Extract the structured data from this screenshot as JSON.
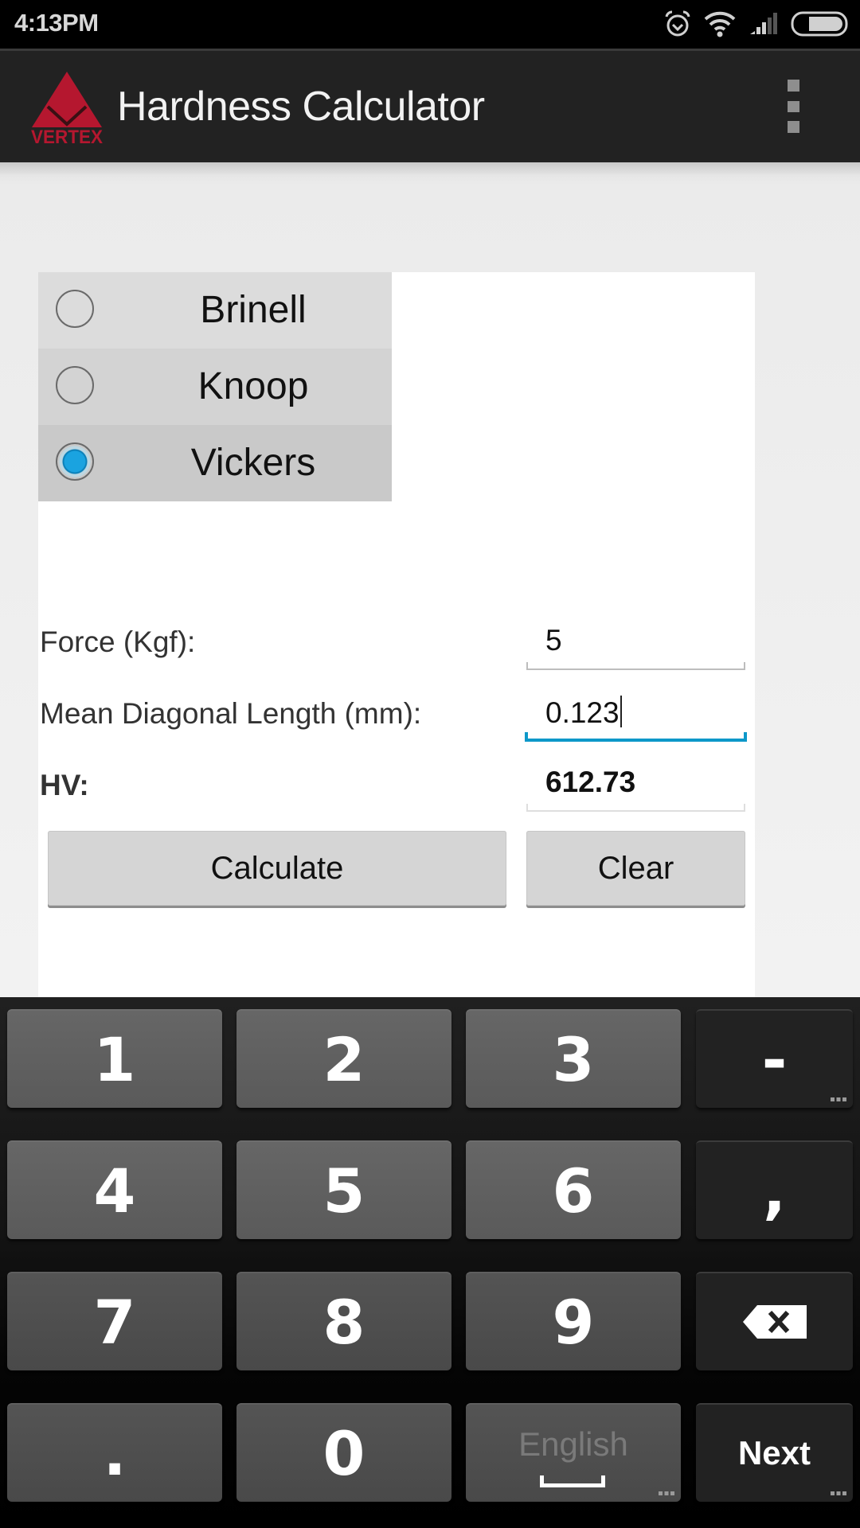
{
  "status_bar": {
    "time": "4:13PM",
    "icons": [
      "alarm-icon",
      "wifi-icon",
      "signal-icon",
      "battery-icon"
    ]
  },
  "action_bar": {
    "logo_text": "VERTEX",
    "title": "Hardness Calculator",
    "overflow_icon": "overflow-menu-icon"
  },
  "colors": {
    "logo_red": "#b5172f",
    "focus_blue": "#0d98c9",
    "radio_selected": "#1aa3e0"
  },
  "hardness_scale": {
    "options": [
      {
        "label": "Brinell",
        "selected": false
      },
      {
        "label": "Knoop",
        "selected": false
      },
      {
        "label": "Vickers",
        "selected": true
      }
    ]
  },
  "form": {
    "force": {
      "label": "Force (Kgf):",
      "value": "5"
    },
    "diagonal": {
      "label": "Mean Diagonal Length (mm):",
      "value": "0.123",
      "focused": true
    },
    "result": {
      "label": "HV:",
      "value": "612.73"
    }
  },
  "buttons": {
    "calculate": "Calculate",
    "clear": "Clear"
  },
  "keyboard": {
    "rows": [
      [
        "1",
        "2",
        "3",
        "-"
      ],
      [
        "4",
        "5",
        "6",
        ","
      ],
      [
        "7",
        "8",
        "9",
        "backspace"
      ],
      [
        ".",
        "0",
        "English",
        "Next"
      ]
    ],
    "space_label": "English",
    "action_label": "Next"
  }
}
